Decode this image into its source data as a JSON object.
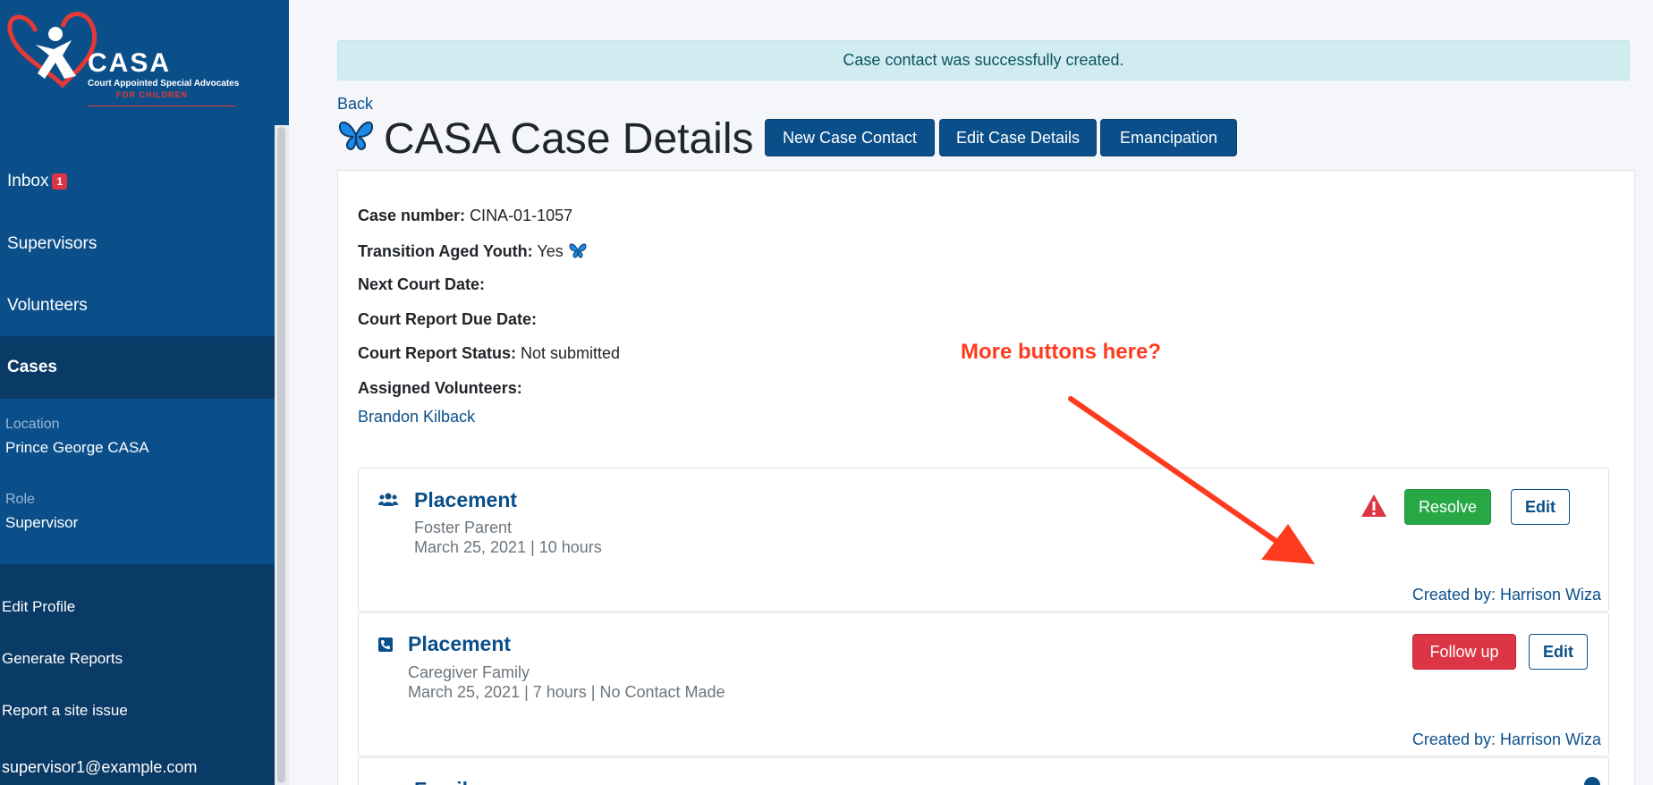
{
  "sidebar": {
    "logo": {
      "text": "CASA",
      "tagline": "Court Appointed Special Advocates",
      "tagline2": "FOR CHILDREN"
    },
    "nav": [
      {
        "label": "Inbox",
        "badge": "1"
      },
      {
        "label": "Supervisors"
      },
      {
        "label": "Volunteers"
      },
      {
        "label": "Cases"
      }
    ],
    "location_label": "Location",
    "location_value": "Prince George CASA",
    "role_label": "Role",
    "role_value": "Supervisor",
    "bottom": [
      "Edit Profile",
      "Generate Reports",
      "Report a site issue",
      "supervisor1@example.com"
    ]
  },
  "alert": "Case contact was successfully created.",
  "back": "Back",
  "title": "CASA Case Details",
  "actions": [
    "New Case Contact",
    "Edit Case Details",
    "Emancipation"
  ],
  "details": {
    "case_number_label": "Case number:",
    "case_number": "CINA-01-1057",
    "tay_label": "Transition Aged Youth:",
    "tay": "Yes",
    "next_court_label": "Next Court Date:",
    "report_due_label": "Court Report Due Date:",
    "report_status_label": "Court Report Status:",
    "report_status": "Not submitted",
    "assigned_label": "Assigned Volunteers:",
    "volunteer": "Brandon Kilback"
  },
  "contacts": [
    {
      "title": "Placement",
      "line1": "Foster Parent",
      "line2": "March 25, 2021 | 10 hours",
      "primary": "Resolve",
      "edit": "Edit",
      "created": "Created by: Harrison Wiza"
    },
    {
      "title": "Placement",
      "line1": "Caregiver Family",
      "line2": "March 25, 2021 | 7 hours | No Contact Made",
      "primary": "Follow up",
      "edit": "Edit",
      "created": "Created by: Harrison Wiza"
    },
    {
      "title": "Family"
    }
  ],
  "annotation": "More buttons here?",
  "colors": {
    "primary": "#0b4f8a",
    "success": "#28a745",
    "danger": "#dc3545",
    "annotation": "#ff3b1f"
  }
}
